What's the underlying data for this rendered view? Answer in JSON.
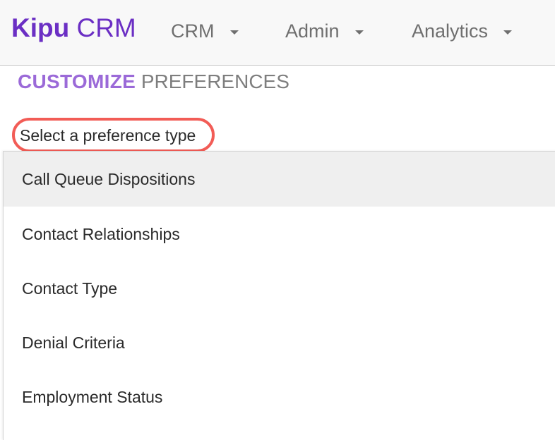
{
  "navbar": {
    "brand_strong": "Kipu",
    "brand_light": " CRM",
    "items": [
      {
        "label": "CRM"
      },
      {
        "label": "Admin"
      },
      {
        "label": "Analytics"
      }
    ]
  },
  "page": {
    "heading_strong": "CUSTOMIZE",
    "heading_light": " PREFERENCES"
  },
  "preference_select": {
    "label": "Select a preference type",
    "options": [
      {
        "label": "Call Queue Dispositions",
        "highlighted": true
      },
      {
        "label": "Contact Relationships"
      },
      {
        "label": "Contact Type"
      },
      {
        "label": "Denial Criteria"
      },
      {
        "label": "Employment Status"
      }
    ]
  },
  "annotation": {
    "highlight_color": "#f25c56"
  }
}
